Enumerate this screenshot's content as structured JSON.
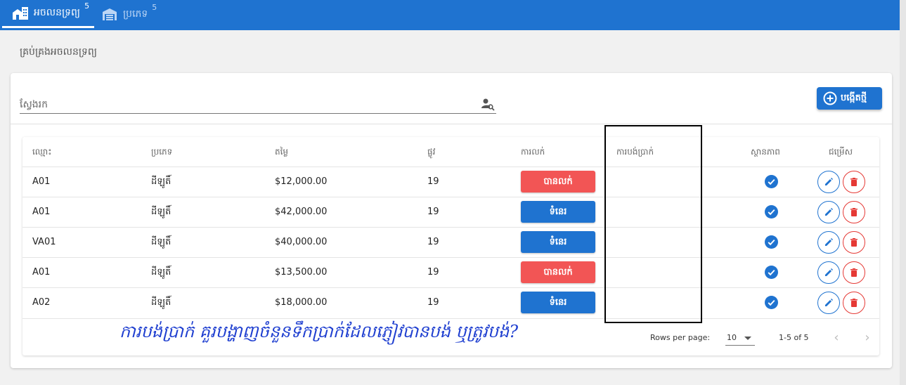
{
  "tabs": [
    {
      "label": "អចលនទ្រព្យ",
      "count": "5",
      "icon": "building-icon"
    },
    {
      "label": "ប្រភេទ",
      "count": "5",
      "icon": "warehouse-icon"
    }
  ],
  "breadcrumb": "គ្រប់គ្រងអចលនទ្រព្យ",
  "search": {
    "placeholder": "ស្វែងរក",
    "icon": "user-search-icon"
  },
  "create_button": {
    "label": "បង្កើតថ្មី",
    "icon": "plus-circle-icon"
  },
  "table": {
    "headers": [
      "ឈ្មោះ",
      "ប្រភេទ",
      "តម្លៃ",
      "ផ្លូវ",
      "ការលក់",
      "ការបង់ប្រាក់",
      "ស្ថានភាព",
      "ជម្រើស"
    ],
    "rows": [
      {
        "name": "A01",
        "type": "ដីឡូតិ៍",
        "price": "$12,000.00",
        "street": "19",
        "sale": "បានលក់",
        "sale_state": "sold",
        "payment": ""
      },
      {
        "name": "A01",
        "type": "ដីឡូតិ៍",
        "price": "$42,000.00",
        "street": "19",
        "sale": "ទំនេរ",
        "sale_state": "free",
        "payment": ""
      },
      {
        "name": "VA01",
        "type": "ដីឡូតិ៍",
        "price": "$40,000.00",
        "street": "19",
        "sale": "ទំនេរ",
        "sale_state": "free",
        "payment": ""
      },
      {
        "name": "A01",
        "type": "ដីឡូតិ៍",
        "price": "$13,500.00",
        "street": "19",
        "sale": "បានលក់",
        "sale_state": "sold",
        "payment": ""
      },
      {
        "name": "A02",
        "type": "ដីឡូតិ៍",
        "price": "$18,000.00",
        "street": "19",
        "sale": "ទំនេរ",
        "sale_state": "free",
        "payment": ""
      }
    ]
  },
  "pagination": {
    "rows_per_page_label": "Rows per page:",
    "rows_per_page": "10",
    "range": "1-5 of 5"
  },
  "annotation": "ការបង់ប្រាក់ គួរបង្ហាញចំនួនទឹកប្រាក់ដែលភ្ញៀវបានបង់ ឬត្រូវបង់?",
  "colors": {
    "primary": "#1f73d0",
    "sold": "#f25555",
    "danger": "#e53935",
    "annotation": "#1f3fd0"
  }
}
